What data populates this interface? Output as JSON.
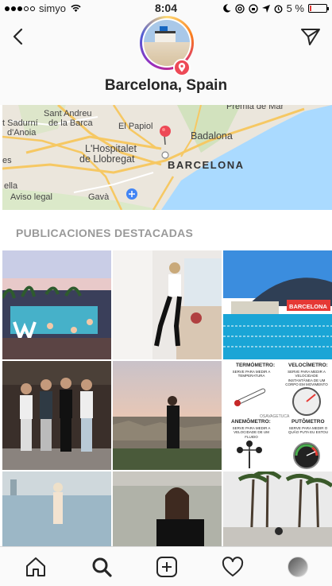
{
  "status_bar": {
    "carrier": "simyo",
    "time": "8:04",
    "battery_percent": "5 %",
    "battery_level": 0.05
  },
  "header": {
    "back_icon": "chevron-left-icon",
    "direct_icon": "paper-plane-icon",
    "location_badge_icon": "location-pin-icon",
    "title": "Barcelona, Spain"
  },
  "map": {
    "labels": {
      "sant_andreu": "Sant Andreu",
      "de_la_barca": "de la Barca",
      "el_papiol": "El Papiol",
      "premia": "Premia de Mar",
      "sant_adurni": "t Sadurní",
      "danoia": "d'Anoia",
      "badalona": "Badalona",
      "hospitalet1": "L'Hospitalet",
      "hospitalet2": "de Llobregat",
      "barcelona": "BARCELONA",
      "legal": "Aviso legal",
      "gava": "Gavà",
      "ella": "ella",
      "es": "es"
    },
    "colors": {
      "land": "#ebe6dc",
      "water": "#aadaff",
      "road": "#f6c863",
      "park": "#c8dfb0",
      "pin": "#ed4956"
    }
  },
  "section": {
    "title": "PUBLICACIONES DESTACADAS"
  },
  "posts": {
    "thermo_title": "TERMÓMETRO:",
    "thermo_desc": "SERVE PARA MEDIR A TEMPERATURA",
    "velo_title": "VELOCÍMETRO:",
    "velo_desc": "SERVE PARA MEDIR A VELOCIDADE INSTANTÂNEA DE UM CORPO EM MOVIMENTO",
    "anemo_title": "ANEMÔMETRO:",
    "anemo_desc": "SERVE PARA MEDIR A VELOCIDADE DE UM FLUIDO",
    "puto_title": "PUTÔMETRO",
    "puto_desc": "SERVE PARA MEDIR O QUÃO PUTA EU ESTOU",
    "watermark": "OSAVAGETUCA",
    "barcelona_sign": "BARCELONA",
    "w_letter": "W"
  },
  "tab_bar": {
    "items": [
      "home-icon",
      "search-icon",
      "new-post-icon",
      "activity-heart-icon",
      "profile-avatar"
    ]
  }
}
